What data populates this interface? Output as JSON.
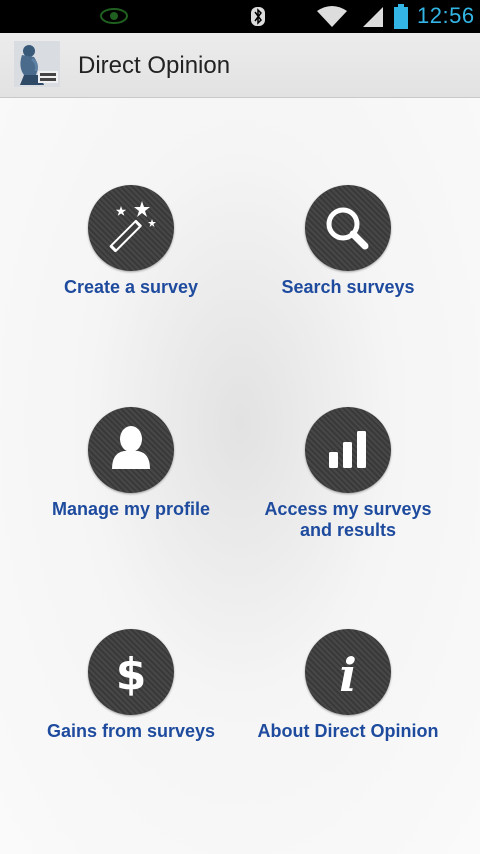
{
  "status_bar": {
    "time": "12:56",
    "accent_color": "#33b5e5",
    "icons": [
      "eye-icon",
      "bluetooth-icon",
      "wifi-icon",
      "signal-icon",
      "battery-icon"
    ]
  },
  "action_bar": {
    "title": "Direct Opinion",
    "logo_icon": "thinker-statue-logo"
  },
  "menu": {
    "label_color": "#1e4b9e",
    "items": [
      {
        "label": "Create a survey",
        "icon": "magic-wand-icon"
      },
      {
        "label": "Search surveys",
        "icon": "search-icon"
      },
      {
        "label": "Manage my profile",
        "icon": "user-icon"
      },
      {
        "label_line1": "Access my surveys",
        "label_line2": "and results",
        "icon": "bar-chart-icon"
      },
      {
        "label": "Gains from surveys",
        "icon": "dollar-icon"
      },
      {
        "label": "About Direct Opinion",
        "icon": "info-icon"
      }
    ]
  }
}
